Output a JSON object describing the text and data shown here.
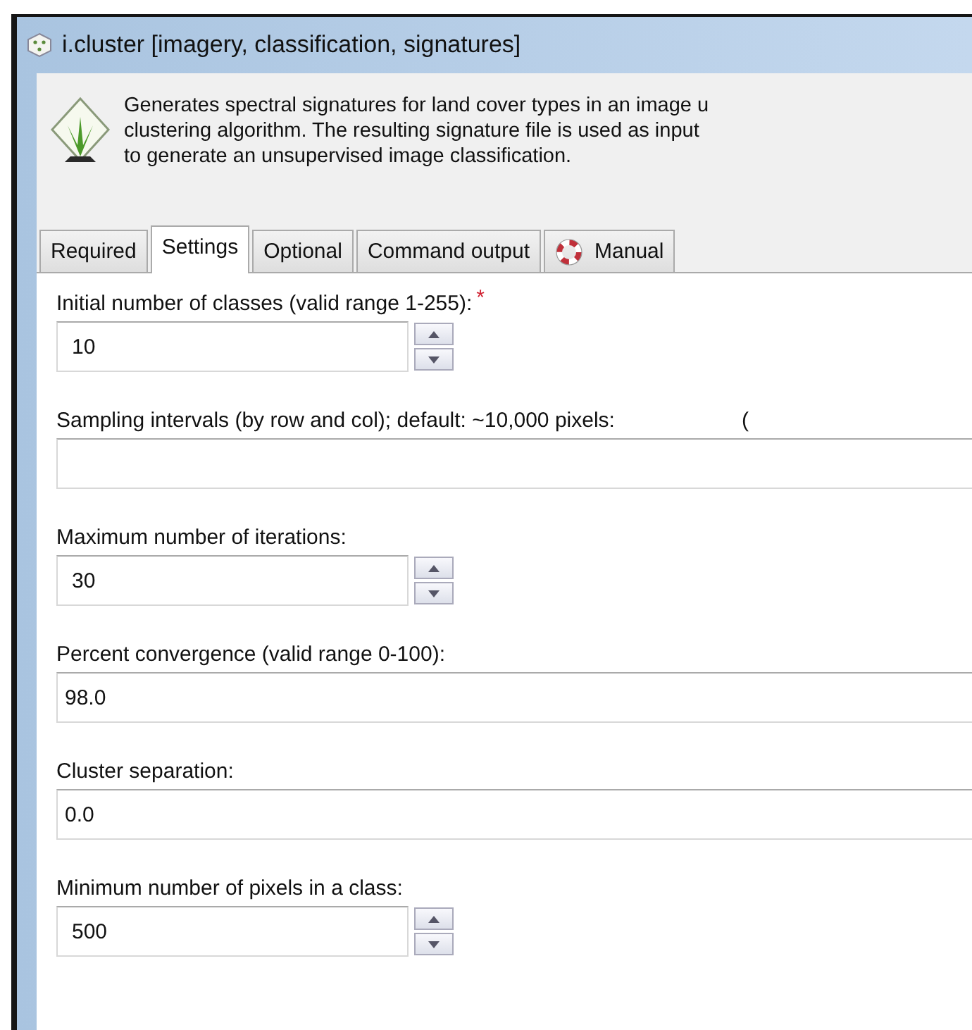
{
  "window": {
    "title": "i.cluster [imagery, classification, signatures]"
  },
  "description": [
    "Generates spectral signatures for land cover types in an image u",
    "clustering algorithm. The resulting signature file is used as input",
    "to generate an unsupervised image classification."
  ],
  "tabs": [
    {
      "label": "Required",
      "selected": false,
      "icon": false
    },
    {
      "label": "Settings",
      "selected": true,
      "icon": false
    },
    {
      "label": "Optional",
      "selected": false,
      "icon": false
    },
    {
      "label": "Command output",
      "selected": false,
      "icon": false
    },
    {
      "label": "Manual",
      "selected": false,
      "icon": true
    }
  ],
  "fields": [
    {
      "label": "Initial number of classes (valid range 1-255):",
      "kind": "spin",
      "value": "10",
      "required": true,
      "required_mark": "*"
    },
    {
      "label": "Sampling intervals (by row and col); default: ~10,000 pixels:",
      "kind": "text",
      "extra": "(",
      "required": false
    },
    {
      "label": "Maximum number of iterations:",
      "kind": "spin",
      "value": "30",
      "required": false
    },
    {
      "label": "Percent convergence (valid range 0-100):",
      "kind": "text",
      "value": "98.0",
      "required": false
    },
    {
      "label": "Cluster separation:",
      "kind": "text",
      "value": "0.0",
      "required": false
    },
    {
      "label": "Minimum number of pixels in a class:",
      "kind": "spin",
      "value": "500",
      "required": false
    }
  ]
}
